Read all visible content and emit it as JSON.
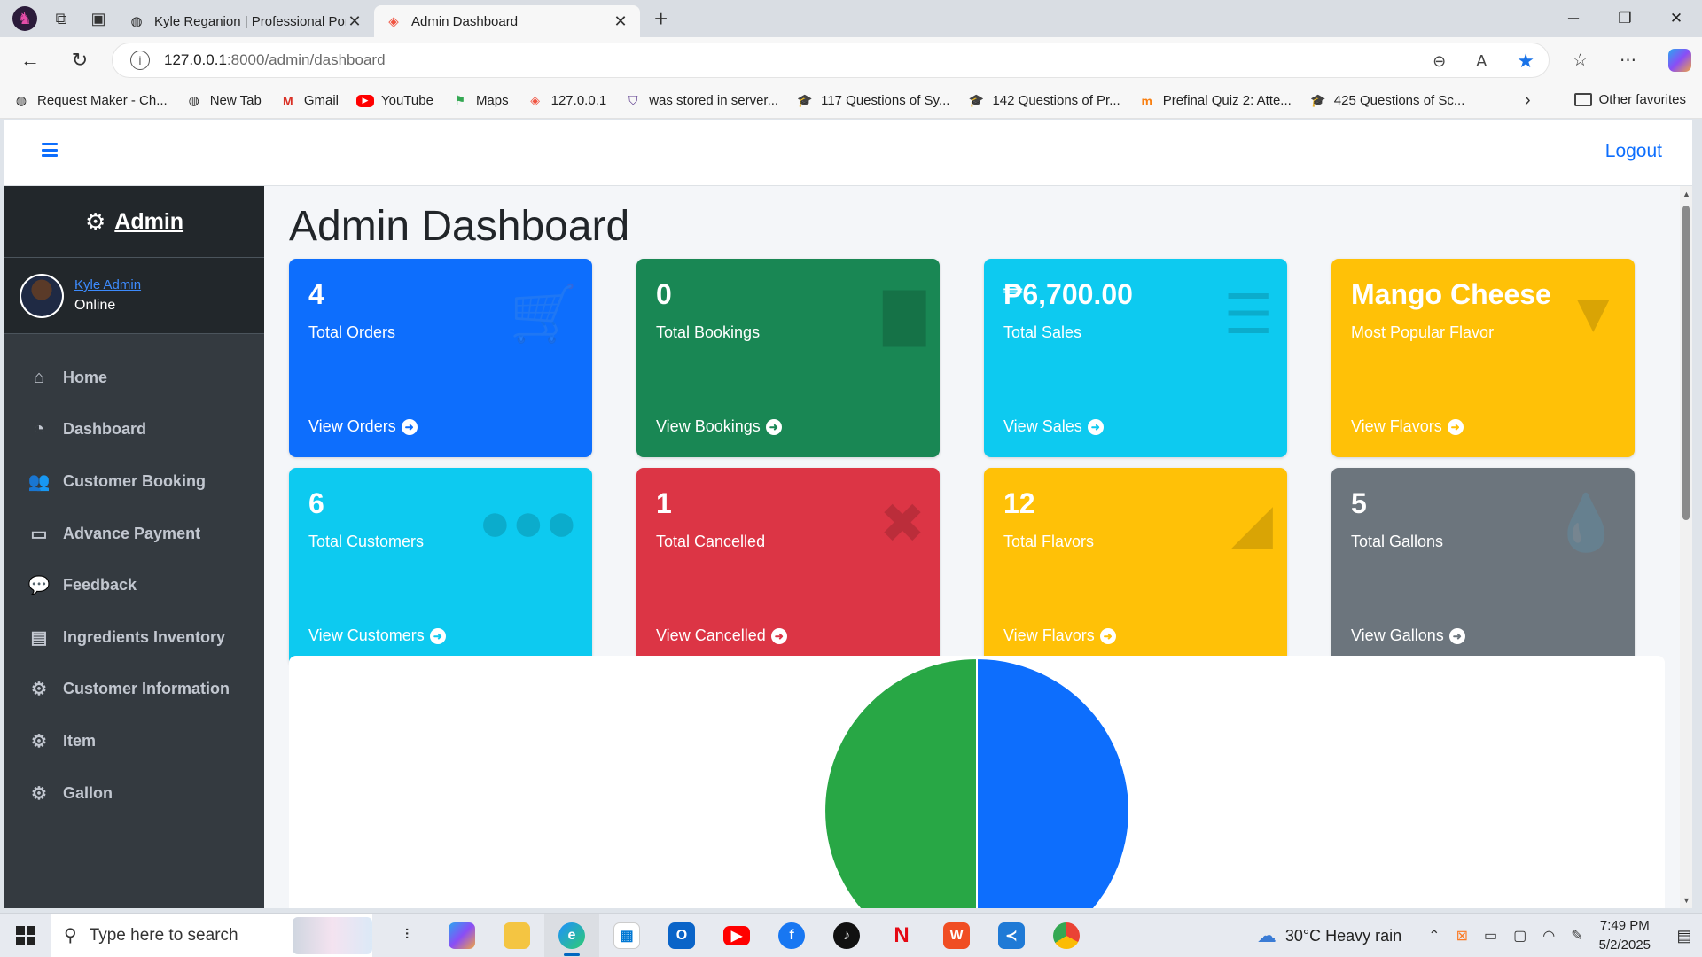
{
  "browser": {
    "tabs": [
      {
        "title": "Kyle Reganion | Professional Portf",
        "active": false
      },
      {
        "title": "Admin Dashboard",
        "active": true
      }
    ],
    "url_host": "127.0.0.1",
    "url_path": ":8000/admin/dashboard",
    "bookmarks": [
      {
        "label": "Request Maker - Ch...",
        "icon": "globe-icon"
      },
      {
        "label": "New Tab",
        "icon": "globe-icon"
      },
      {
        "label": "Gmail",
        "icon": "gmail-icon"
      },
      {
        "label": "YouTube",
        "icon": "youtube-icon"
      },
      {
        "label": "Maps",
        "icon": "maps-icon"
      },
      {
        "label": "127.0.0.1",
        "icon": "laravel-icon"
      },
      {
        "label": "was stored in server...",
        "icon": "shield-icon"
      },
      {
        "label": "117 Questions of Sy...",
        "icon": "graduation-cap-icon"
      },
      {
        "label": "142 Questions of Pr...",
        "icon": "graduation-cap-icon"
      },
      {
        "label": "Prefinal Quiz 2: Atte...",
        "icon": "moodle-icon"
      },
      {
        "label": "425 Questions of Sc...",
        "icon": "graduation-cap-icon"
      }
    ],
    "other_favorites": "Other favorites"
  },
  "navbar": {
    "logout": "Logout"
  },
  "sidebar": {
    "brand": "Admin",
    "user_name": "Kyle Admin",
    "user_status": "Online",
    "items": [
      {
        "label": "Home",
        "icon": "home-icon",
        "glyph": "⌂"
      },
      {
        "label": "Dashboard",
        "icon": "tachometer-icon",
        "glyph": "◔"
      },
      {
        "label": "Customer Booking",
        "icon": "users-icon",
        "glyph": "👥"
      },
      {
        "label": "Advance Payment",
        "icon": "credit-card-icon",
        "glyph": "▭"
      },
      {
        "label": "Feedback",
        "icon": "comments-icon",
        "glyph": "💬"
      },
      {
        "label": "Ingredients Inventory",
        "icon": "archive-icon",
        "glyph": "▤"
      },
      {
        "label": "Customer Information",
        "icon": "users-cog-icon",
        "glyph": "⚙"
      },
      {
        "label": "Item",
        "icon": "cogs-icon",
        "glyph": "⚙"
      },
      {
        "label": "Gallon",
        "icon": "cogs-icon",
        "glyph": "⚙"
      }
    ]
  },
  "main": {
    "title": "Admin Dashboard",
    "cards": [
      {
        "value": "4",
        "label": "Total Orders",
        "link": "View Orders",
        "color": "#0d6efd",
        "icon": "shopping-cart-icon"
      },
      {
        "value": "0",
        "label": "Total Bookings",
        "link": "View Bookings",
        "color": "#198754",
        "icon": "book-icon"
      },
      {
        "value": "₱6,700.00",
        "label": "Total Sales",
        "link": "View Sales",
        "color": "#0dcaf0",
        "icon": "coins-icon"
      },
      {
        "value": "Mango Cheese",
        "label": "Most Popular Flavor",
        "link": "View Flavors",
        "color": "#ffc107",
        "icon": "ice-cream-icon"
      },
      {
        "value": "6",
        "label": "Total Customers",
        "link": "View Customers",
        "color": "#0dcaf0",
        "icon": "users-icon"
      },
      {
        "value": "1",
        "label": "Total Cancelled",
        "link": "View Cancelled",
        "color": "#dc3545",
        "icon": "times-circle-icon"
      },
      {
        "value": "12",
        "label": "Total Flavors",
        "link": "View Flavors",
        "color": "#ffc107",
        "icon": "pizza-slice-icon"
      },
      {
        "value": "5",
        "label": "Total Gallons",
        "link": "View Gallons",
        "color": "#6c757d",
        "icon": "tint-icon"
      }
    ]
  },
  "chart_data": {
    "type": "pie",
    "slices": [
      {
        "value": 50,
        "color": "#0d6efd"
      },
      {
        "value": 50,
        "color": "#28a745"
      }
    ]
  },
  "taskbar": {
    "search_placeholder": "Type here to search",
    "weather": "30°C  Heavy rain",
    "time": "7:49 PM",
    "date": "5/2/2025"
  }
}
